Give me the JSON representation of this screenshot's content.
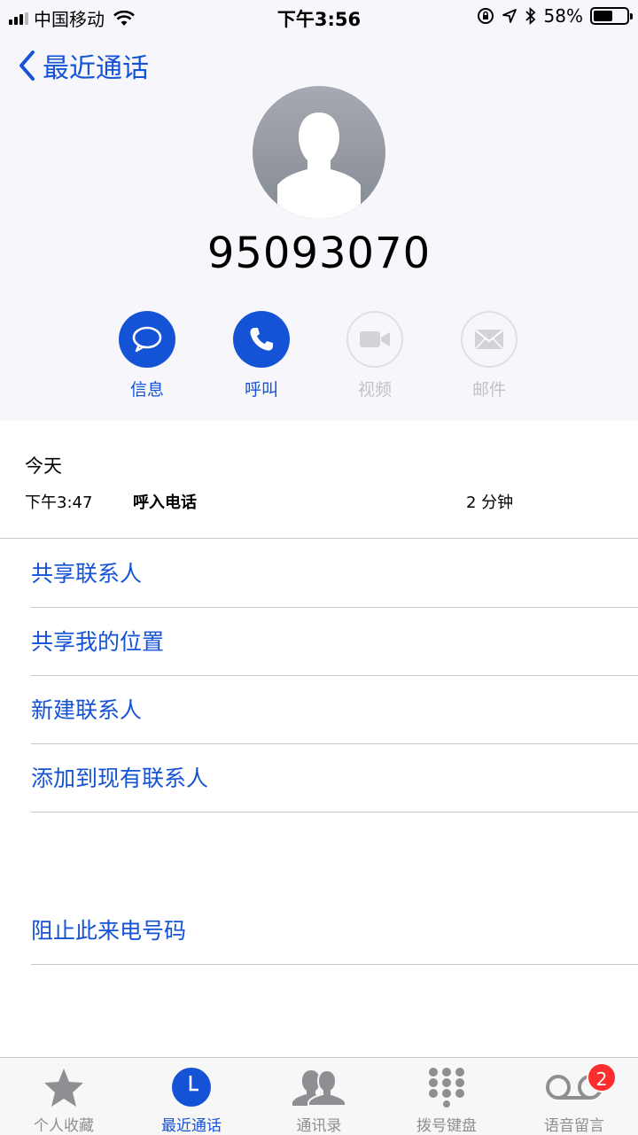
{
  "status_bar": {
    "carrier": "中国移动",
    "time": "下午3:56",
    "battery_percent": "58%",
    "battery_level": 0.58,
    "icons": [
      "signal-icon",
      "wifi-icon",
      "orientation-lock-icon",
      "location-icon",
      "bluetooth-icon",
      "battery-icon"
    ]
  },
  "nav": {
    "back_label": "最近通话"
  },
  "contact": {
    "number": "95093070"
  },
  "actions": [
    {
      "label": "信息",
      "icon": "message-icon",
      "enabled": true
    },
    {
      "label": "呼叫",
      "icon": "phone-icon",
      "enabled": true
    },
    {
      "label": "视频",
      "icon": "video-icon",
      "enabled": false
    },
    {
      "label": "邮件",
      "icon": "mail-icon",
      "enabled": false
    }
  ],
  "history": {
    "day": "今天",
    "entries": [
      {
        "time": "下午3:47",
        "type": "呼入电话",
        "duration": "2 分钟"
      }
    ]
  },
  "options": [
    "共享联系人",
    "共享我的位置",
    "新建联系人",
    "添加到现有联系人"
  ],
  "block_option": "阻止此来电号码",
  "tabs": [
    {
      "label": "个人收藏",
      "icon": "star-icon",
      "active": false
    },
    {
      "label": "最近通话",
      "icon": "clock-icon",
      "active": true
    },
    {
      "label": "通讯录",
      "icon": "contacts-icon",
      "active": false
    },
    {
      "label": "拨号键盘",
      "icon": "keypad-icon",
      "active": false
    },
    {
      "label": "语音留言",
      "icon": "voicemail-icon",
      "active": false,
      "badge": "2"
    }
  ],
  "colors": {
    "accent": "#1452d6",
    "badge": "#ff2d2d",
    "inactive": "#8e8e93",
    "disabled": "#c2c2c6"
  }
}
